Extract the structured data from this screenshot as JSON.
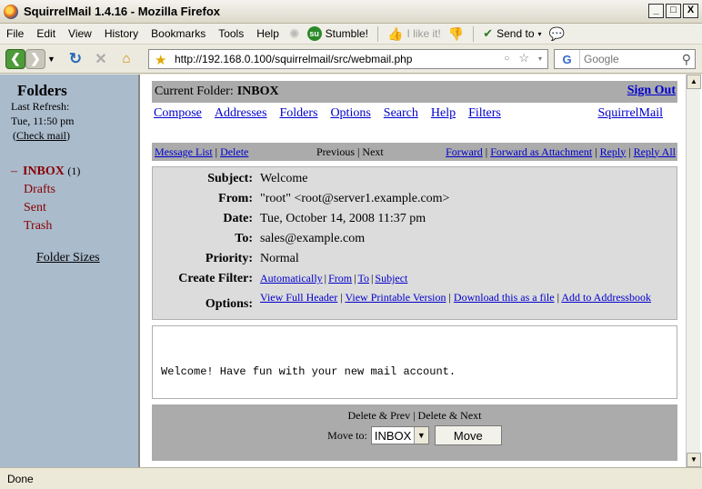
{
  "window": {
    "title": "SquirrelMail 1.4.16 - Mozilla Firefox",
    "controls": [
      "_",
      "□",
      "X"
    ]
  },
  "menubar": {
    "items": [
      "File",
      "Edit",
      "View",
      "History",
      "Bookmarks",
      "Tools",
      "Help"
    ],
    "stumble": "Stumble!",
    "ilikeit": "I like it!",
    "sendto": "Send to"
  },
  "navbar": {
    "url": "http://192.168.0.100/squirrelmail/src/webmail.php",
    "search_placeholder": "Google"
  },
  "leftpane": {
    "title": "Folders",
    "last_refresh_label": "Last Refresh:",
    "last_refresh_value": "Tue, 11:50 pm",
    "check_mail": "Check mail",
    "folders": [
      {
        "name": "INBOX",
        "count": "(1)",
        "toggle": "–"
      },
      {
        "name": "Drafts"
      },
      {
        "name": "Sent"
      },
      {
        "name": "Trash"
      }
    ],
    "folder_sizes": "Folder Sizes"
  },
  "header": {
    "current_folder_label": "Current Folder:",
    "current_folder": "INBOX",
    "sign_out": "Sign Out"
  },
  "toplinks": [
    "Compose",
    "Addresses",
    "Folders",
    "Options",
    "Search",
    "Help",
    "Filters"
  ],
  "brand_link": "SquirrelMail",
  "msgnav": {
    "message_list": "Message List",
    "delete": "Delete",
    "previous": "Previous",
    "next": "Next",
    "forward": "Forward",
    "forward_attachment": "Forward as Attachment",
    "reply": "Reply",
    "reply_all": "Reply All"
  },
  "headers": {
    "subject_label": "Subject:",
    "subject": "Welcome",
    "from_label": "From:",
    "from": "\"root\" <root@server1.example.com>",
    "date_label": "Date:",
    "date": "Tue, October 14, 2008 11:37 pm",
    "to_label": "To:",
    "to": "sales@example.com",
    "priority_label": "Priority:",
    "priority": "Normal",
    "create_filter_label": "Create Filter:",
    "filter_links": [
      "Automatically",
      "From",
      "To",
      "Subject"
    ],
    "options_label": "Options:",
    "option_links": [
      "View Full Header",
      "View Printable Version",
      "Download this as a file",
      "Add to Addressbook"
    ]
  },
  "body": {
    "text": "Welcome! Have fun with your new mail account."
  },
  "bottom": {
    "delete_prev": "Delete & Prev",
    "delete_next": "Delete & Next",
    "move_to_label": "Move to:",
    "move_to_value": "INBOX",
    "move_button": "Move"
  },
  "status": {
    "text": "Done"
  }
}
